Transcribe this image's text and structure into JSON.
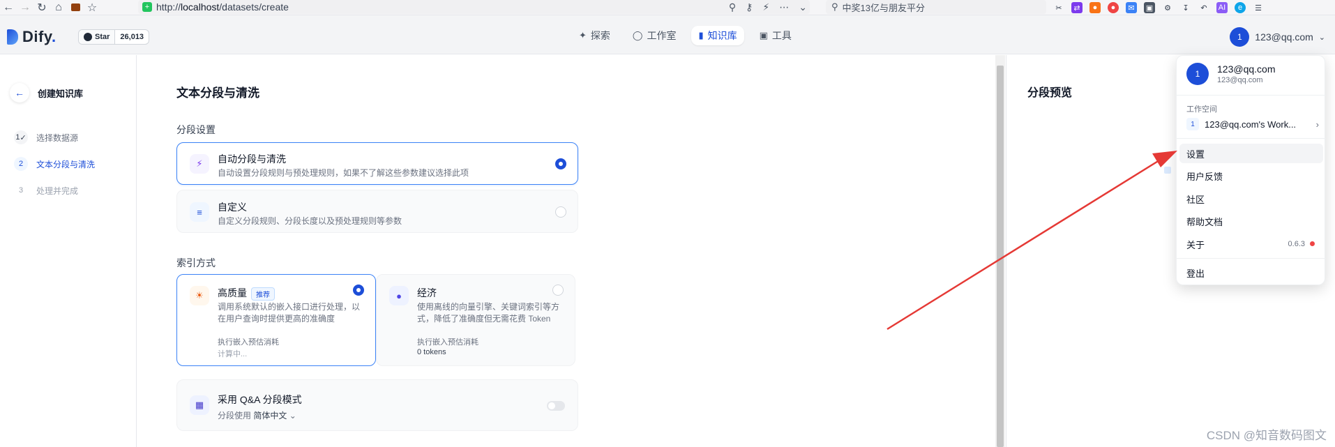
{
  "browser": {
    "url_prefix": "http://",
    "url_host": "localhost",
    "url_path": "/datasets/create",
    "search_text": "中奖13亿与朋友平分"
  },
  "header": {
    "logo_text": "Dify",
    "logo_dot": ".",
    "star_label": "Star",
    "star_count": "26,013",
    "nav": [
      {
        "label": "探索",
        "icon": "compass-icon"
      },
      {
        "label": "工作室",
        "icon": "robot-icon"
      },
      {
        "label": "知识库",
        "icon": "book-icon"
      },
      {
        "label": "工具",
        "icon": "toolbox-icon"
      }
    ],
    "user_initial": "1",
    "user_email": "123@qq.com"
  },
  "stepper": {
    "title": "创建知识库",
    "steps": [
      {
        "num": "1",
        "label": "选择数据源",
        "state": "done"
      },
      {
        "num": "2",
        "label": "文本分段与清洗",
        "state": "active"
      },
      {
        "num": "3",
        "label": "处理并完成",
        "state": "todo"
      }
    ]
  },
  "main": {
    "title": "文本分段与清洗",
    "segment_label": "分段设置",
    "options": [
      {
        "title": "自动分段与清洗",
        "desc": "自动设置分段规则与预处理规则，如果不了解这些参数建议选择此项",
        "selected": true
      },
      {
        "title": "自定义",
        "desc": "自定义分段规则、分段长度以及预处理规则等参数",
        "selected": false
      }
    ],
    "index_label": "索引方式",
    "index_options": [
      {
        "title": "高质量",
        "badge": "推荐",
        "desc": "调用系统默认的嵌入接口进行处理，以在用户查询时提供更高的准确度",
        "meta_label": "执行嵌入预估消耗",
        "meta_value": "计算中...",
        "selected": true
      },
      {
        "title": "经济",
        "desc": "使用离线的向量引擎、关键词索引等方式，降低了准确度但无需花费 Token",
        "meta_label": "执行嵌入预估消耗",
        "meta_value": "0 tokens",
        "selected": false
      }
    ],
    "qa": {
      "title": "采用 Q&A 分段模式",
      "sub_prefix": "分段使用",
      "language": "简体中文"
    }
  },
  "preview": {
    "title": "分段预览"
  },
  "dropdown": {
    "name": "123@qq.com",
    "email": "123@qq.com",
    "workspace_label": "工作空间",
    "workspace_num": "1",
    "workspace_name": "123@qq.com's Work...",
    "items": [
      "设置",
      "用户反馈",
      "社区",
      "帮助文档",
      "关于",
      "登出"
    ],
    "version": "0.6.3"
  },
  "annotation": {
    "arrow_color": "#e53935"
  },
  "watermark": "CSDN @知音数码图文",
  "colors": {
    "accent": "#1d4ed8",
    "selected_border": "#3b82f6",
    "status_dot": "#ef4444"
  }
}
